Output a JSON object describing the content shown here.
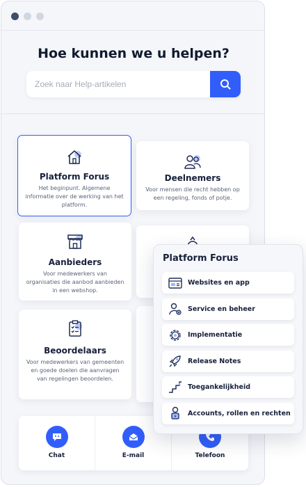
{
  "hero": {
    "title": "Hoe kunnen we u helpen?",
    "search_placeholder": "Zoek naar Help-artikelen"
  },
  "cards": [
    {
      "title": "Platform Forus",
      "description": "Het beginpunt. Algemene informatie over de werking van het platform.",
      "icon": "home-icon",
      "selected": true
    },
    {
      "title": "Deelnemers",
      "description": "Voor mensen die recht hebben op een regeling, fonds of potje.",
      "icon": "users-icon",
      "selected": false
    },
    {
      "title": "Aanbieders",
      "description": "Voor medewerkers van organisaties die aanbod aanbieden in een webshop.",
      "icon": "store-icon",
      "selected": false
    },
    {
      "title": "",
      "description": "",
      "icon": "money-bag-icon",
      "selected": false
    },
    {
      "title": "Beoordelaars",
      "description": "Voor medewerkers van gemeenten en goede doelen die aanvragen van regelingen beoordelen.",
      "icon": "clipboard-icon",
      "selected": false
    }
  ],
  "contact": [
    {
      "label": "Chat",
      "icon": "chat-icon"
    },
    {
      "label": "E-mail",
      "icon": "mail-icon"
    },
    {
      "label": "Telefoon",
      "icon": "phone-icon"
    }
  ],
  "popup": {
    "title": "Platform Forus",
    "items": [
      {
        "label": "Websites en app",
        "icon": "browser-icon"
      },
      {
        "label": "Service en beheer",
        "icon": "user-settings-icon"
      },
      {
        "label": "Implementatie",
        "icon": "gear-icon"
      },
      {
        "label": "Release Notes",
        "icon": "rocket-icon"
      },
      {
        "label": "Toegankelijkheid",
        "icon": "stairs-icon"
      },
      {
        "label": "Accounts, rollen en rechten",
        "icon": "account-lock-icon"
      }
    ]
  },
  "colors": {
    "accent": "#315efb",
    "icon_dark": "#1f2d55",
    "icon_accent": "#9fb4ff"
  }
}
